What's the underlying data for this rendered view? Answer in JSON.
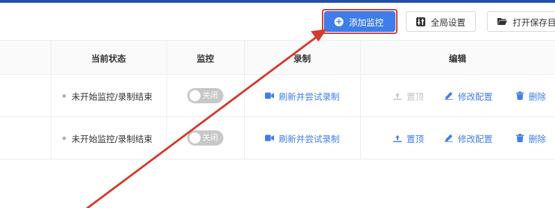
{
  "colors": {
    "accent": "#3f7ee8",
    "annotation_arrow": "#d33a2c",
    "disabled": "#c2c2c2",
    "toggle_off": "#c8c8c8"
  },
  "toolbar": {
    "add_button": {
      "label": "添加监控",
      "icon": "plus-circle-icon"
    },
    "settings_button": {
      "label": "全局设置",
      "icon": "settings-icon"
    },
    "open_folder_button": {
      "label": "打开保存目",
      "icon": "folder-open-icon"
    }
  },
  "table": {
    "headers": {
      "status": "当前状态",
      "monitor": "监控",
      "record": "录制",
      "edit": "编辑"
    },
    "rows": [
      {
        "status": "未开始监控/录制结束",
        "toggle_label": "关闭",
        "record_action": "刷新并尝试录制",
        "pin_action": "置顶",
        "pin_disabled": true,
        "edit_action": "修改配置",
        "delete_action": "删除"
      },
      {
        "status": "未开始监控/录制结束",
        "toggle_label": "关闭",
        "record_action": "刷新并尝试录制",
        "pin_action": "置顶",
        "pin_disabled": false,
        "edit_action": "修改配置",
        "delete_action": "删除"
      }
    ]
  },
  "annotation": {
    "type": "arrow",
    "points_to": "add-monitor-button",
    "highlight": "box"
  }
}
